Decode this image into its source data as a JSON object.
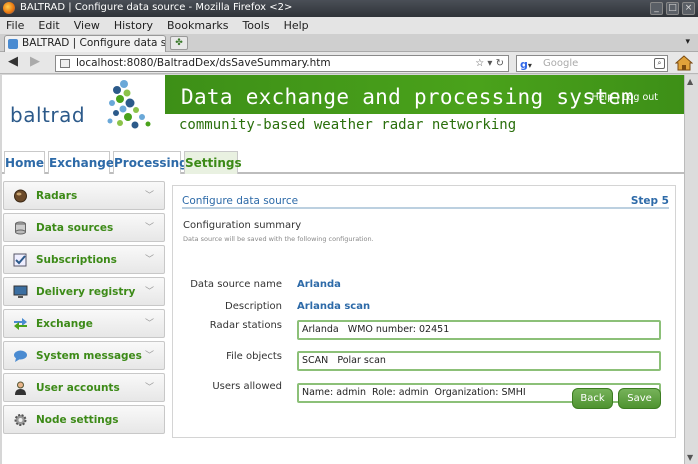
{
  "window": {
    "title": "BALTRAD | Configure data source - Mozilla Firefox <2>"
  },
  "menu": [
    "File",
    "Edit",
    "View",
    "History",
    "Bookmarks",
    "Tools",
    "Help"
  ],
  "tabs": {
    "active_tab": "BALTRAD | Configure data source",
    "new_tab_symbol": "✤"
  },
  "navbar": {
    "url": "localhost:8080/BaltradDex/dsSaveSummary.htm",
    "search_placeholder": "Google",
    "search_engine_letter": "g"
  },
  "header": {
    "logo": "baltrad",
    "title": "Data exchange and processing system",
    "help_link": "Help",
    "separator": "|",
    "logout_link": "Log out",
    "tagline": "community-based weather radar networking"
  },
  "main_nav": [
    "Home",
    "Exchange",
    "Processing",
    "Settings"
  ],
  "sidebar": [
    {
      "label": "Radars",
      "icon": "radar-globe-icon"
    },
    {
      "label": "Data sources",
      "icon": "database-icon"
    },
    {
      "label": "Subscriptions",
      "icon": "checkbox-icon"
    },
    {
      "label": "Delivery registry",
      "icon": "monitor-icon"
    },
    {
      "label": "Exchange",
      "icon": "exchange-arrows-icon"
    },
    {
      "label": "System messages",
      "icon": "chat-bubble-icon"
    },
    {
      "label": "User accounts",
      "icon": "user-icon"
    },
    {
      "label": "Node settings",
      "icon": "gear-icon"
    }
  ],
  "panel": {
    "title": "Configure data source",
    "step": "Step 5",
    "summary_heading": "Configuration summary",
    "summary_note": "Data source will be saved with the following configuration.",
    "fields": [
      {
        "label": "Data source name",
        "value": "Arlanda"
      },
      {
        "label": "Description",
        "value": "Arlanda scan"
      },
      {
        "label": "Radar stations",
        "value": "Arlanda   WMO number: 02451"
      },
      {
        "label": "File objects",
        "value": "SCAN   Polar scan"
      },
      {
        "label": "Users allowed",
        "value": "Name: admin  Role: admin  Organization: SMHI"
      }
    ],
    "back_label": "Back",
    "save_label": "Save"
  },
  "colors": {
    "brand_green": "#4aa21b",
    "link_blue": "#2d6aa8",
    "label_green": "#3c8a17"
  }
}
